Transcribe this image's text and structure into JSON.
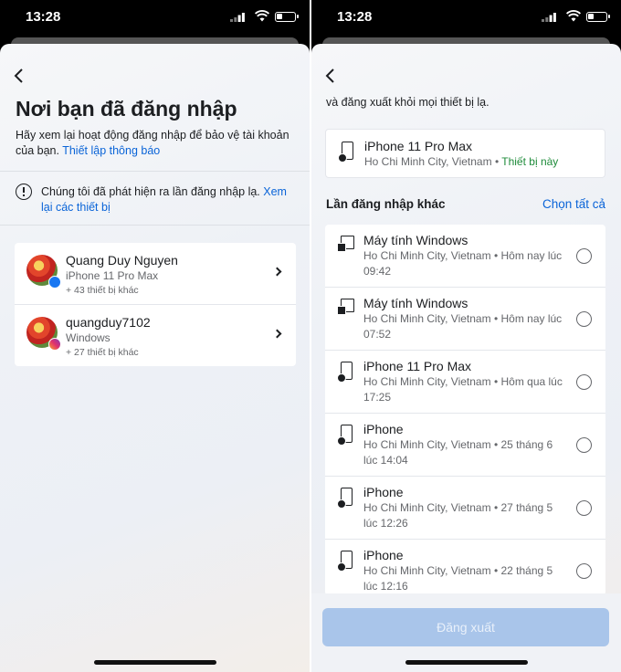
{
  "status_bar": {
    "time": "13:28"
  },
  "left_screen": {
    "title": "Nơi bạn đã đăng nhập",
    "description": "Hãy xem lại hoạt động đăng nhập để bảo vệ tài khoản của bạn.",
    "notification_link": "Thiết lập thông báo",
    "alert_text": "Chúng tôi đã phát hiện ra lần đăng nhập lạ.",
    "alert_link": "Xem lại các thiết bị",
    "accounts": [
      {
        "name": "Quang Duy Nguyen",
        "device": "iPhone 11 Pro Max",
        "more": "+ 43 thiết bị khác",
        "badge": "facebook"
      },
      {
        "name": "quangduy7102",
        "device": "Windows",
        "more": "+ 27 thiết bị khác",
        "badge": "instagram"
      }
    ]
  },
  "right_screen": {
    "top_text": "và đăng xuất khỏi mọi thiết bị lạ.",
    "current_device": {
      "name": "iPhone 11 Pro Max",
      "location": "Ho Chi Minh City, Vietnam",
      "separator": " • ",
      "tag": "Thiết bị này"
    },
    "section_label": "Lần đăng nhập khác",
    "select_all": "Chọn tất cả",
    "sessions": [
      {
        "name": "Máy tính Windows",
        "location": "Ho Chi Minh City, Vietnam • Hôm nay lúc 09:42",
        "icon": "windows-pc"
      },
      {
        "name": "Máy tính Windows",
        "location": "Ho Chi Minh City, Vietnam • Hôm nay lúc 07:52",
        "icon": "windows-pc"
      },
      {
        "name": "iPhone 11 Pro Max",
        "location": "Ho Chi Minh City, Vietnam • Hôm qua lúc 17:25",
        "icon": "iphone"
      },
      {
        "name": "iPhone",
        "location": "Ho Chi Minh City, Vietnam • 25 tháng 6 lúc 14:04",
        "icon": "iphone"
      },
      {
        "name": "iPhone",
        "location": "Ho Chi Minh City, Vietnam • 27 tháng 5 lúc 12:26",
        "icon": "iphone"
      },
      {
        "name": "iPhone",
        "location": "Ho Chi Minh City, Vietnam • 22 tháng 5 lúc 12:16",
        "icon": "iphone"
      }
    ],
    "logout_button": "Đăng xuất"
  },
  "colors": {
    "link": "#0a64d8",
    "current_tag": "#1e8b3a",
    "logout_disabled": "#a9c5ea"
  }
}
